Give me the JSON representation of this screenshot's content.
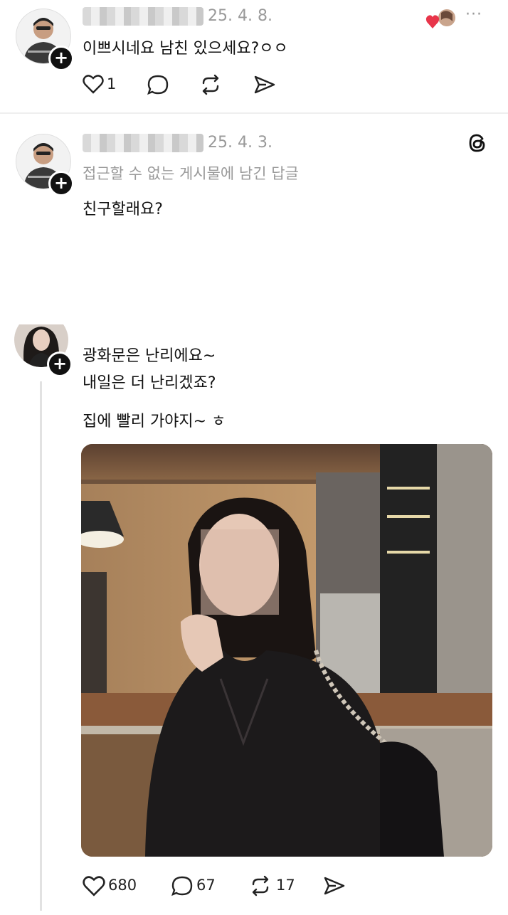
{
  "post1": {
    "date": "25. 4. 8.",
    "body": "이쁘시네요 남친 있으세요?ㅇㅇ",
    "like_count": "1",
    "more_label": "···"
  },
  "post2": {
    "date": "25. 4. 3.",
    "context": "접근할 수 없는 게시물에 남긴 답글",
    "body": "친구할래요?"
  },
  "post3": {
    "line1": "광화문은 난리에요~",
    "line2": "내일은 더 난리겠죠?",
    "line3": "집에 빨리 가야지~ ㅎ",
    "likes": "680",
    "comments": "67",
    "reposts": "17"
  },
  "icons": [
    "heart-icon",
    "comment-icon",
    "repost-icon",
    "share-icon",
    "threads-icon",
    "more-icon",
    "plus-icon"
  ],
  "colors": {
    "heart_red": "#e8354a",
    "muted_text": "#999999"
  }
}
